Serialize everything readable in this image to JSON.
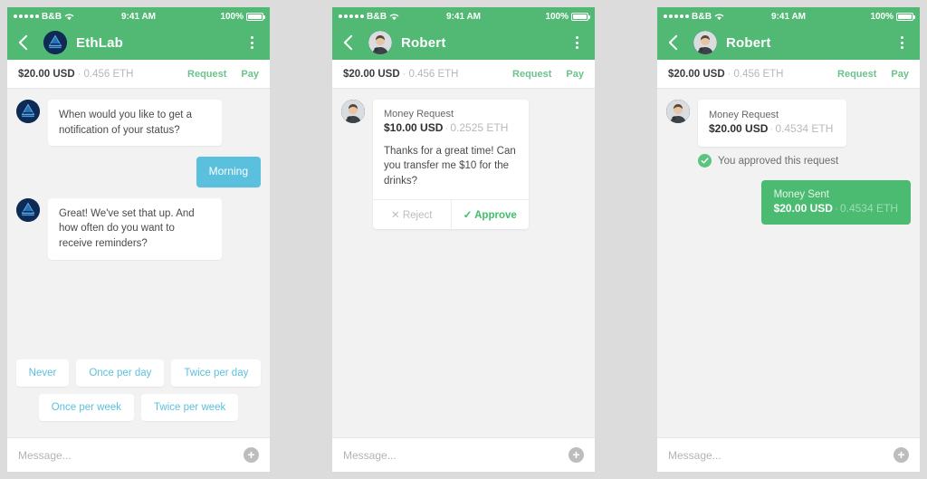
{
  "status_bar": {
    "carrier": "B&B",
    "time": "9:41 AM",
    "battery_pct": "100%",
    "signal_dots": 5,
    "wifi_icon": "wifi-icon",
    "battery_icon": "battery-full-icon"
  },
  "colors": {
    "header_green": "#52b974",
    "accent_green": "#6ac48a",
    "approve_green": "#3fbf6a",
    "sent_green": "#4cbb72",
    "user_blue": "#5bc0de",
    "chip_blue": "#5bc0de",
    "page_bg": "#dcdcdc",
    "chat_bg": "#f2f2f2",
    "avatar_navy": "#0f2a52"
  },
  "panels": [
    {
      "nav": {
        "back_icon": "chevron-left-icon",
        "title": "EthLab",
        "avatar": "ethlab-logo-avatar",
        "menu_icon": "kebab-menu-icon"
      },
      "balance": {
        "usd": "$20.00 USD",
        "separator": "·",
        "eth": "0.456 ETH",
        "request_label": "Request",
        "pay_label": "Pay"
      },
      "messages": [
        {
          "kind": "bot",
          "text": "When would you like to get a notification of your status?"
        },
        {
          "kind": "user",
          "text": "Morning"
        },
        {
          "kind": "bot",
          "text": "Great! We've set that up. And how often do you want to receive reminders?"
        }
      ],
      "quick_replies": [
        [
          "Never",
          "Once per day",
          "Twice per day"
        ],
        [
          "Once per week",
          "Twice per week"
        ]
      ],
      "composer": {
        "placeholder": "Message...",
        "add_icon": "plus-circle-icon"
      }
    },
    {
      "nav": {
        "back_icon": "chevron-left-icon",
        "title": "Robert",
        "avatar": "robert-photo-avatar",
        "menu_icon": "kebab-menu-icon"
      },
      "balance": {
        "usd": "$20.00 USD",
        "separator": "·",
        "eth": "0.456 ETH",
        "request_label": "Request",
        "pay_label": "Pay"
      },
      "request_card": {
        "title": "Money Request",
        "amount_usd": "$10.00 USD",
        "separator": "·",
        "amount_eth": "0.2525 ETH",
        "message": "Thanks for a great time! Can you transfer me $10 for the drinks?",
        "reject_label": "Reject",
        "reject_icon": "x-icon",
        "approve_label": "Approve",
        "approve_icon": "check-icon"
      },
      "composer": {
        "placeholder": "Message...",
        "add_icon": "plus-circle-icon"
      }
    },
    {
      "nav": {
        "back_icon": "chevron-left-icon",
        "title": "Robert",
        "avatar": "robert-photo-avatar",
        "menu_icon": "kebab-menu-icon"
      },
      "balance": {
        "usd": "$20.00 USD",
        "separator": "·",
        "eth": "0.456 ETH",
        "request_label": "Request",
        "pay_label": "Pay"
      },
      "request_card": {
        "title": "Money Request",
        "amount_usd": "$20.00 USD",
        "separator": "·",
        "amount_eth": "0.4534 ETH"
      },
      "approved_notice": {
        "icon": "check-circle-icon",
        "text": "You approved this request"
      },
      "sent_bubble": {
        "title": "Money Sent",
        "amount_usd": "$20.00 USD",
        "separator": "·",
        "amount_eth": "0.4534 ETH"
      },
      "composer": {
        "placeholder": "Message...",
        "add_icon": "plus-circle-icon"
      }
    }
  ]
}
